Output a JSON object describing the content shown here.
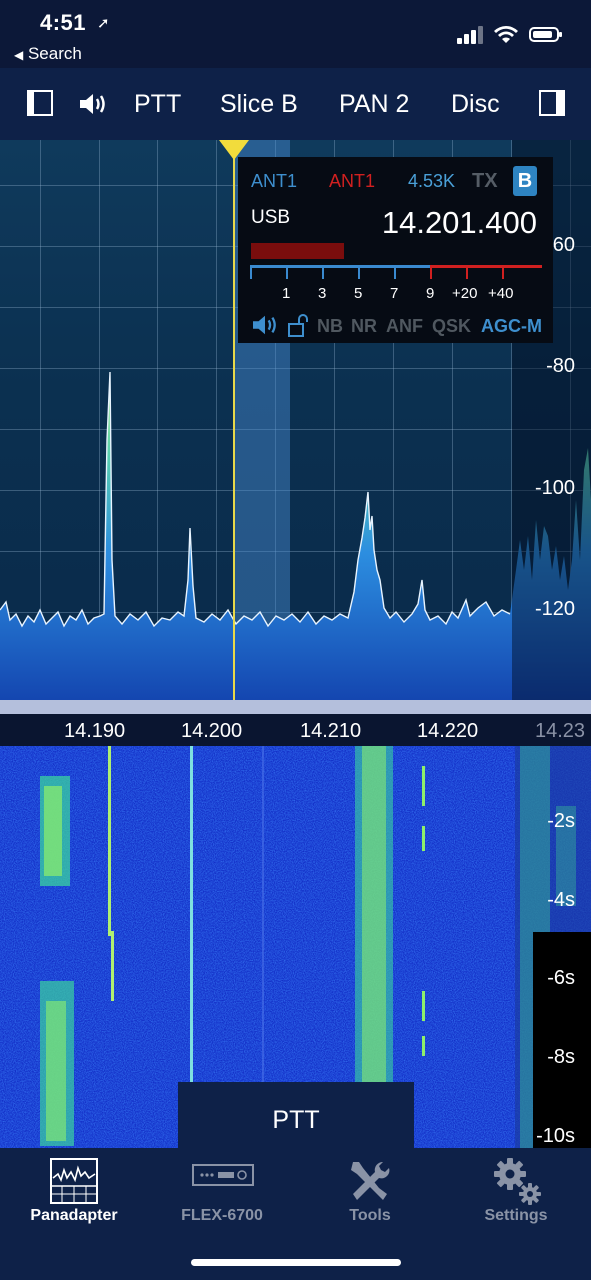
{
  "status_bar": {
    "time": "4:51",
    "back_label": "Search"
  },
  "toolbar": {
    "ptt": "PTT",
    "slice": "Slice B",
    "pan": "PAN 2",
    "disc": "Disc"
  },
  "panadapter": {
    "dbm_labels": [
      "-60",
      "-80",
      "-100",
      "-120"
    ]
  },
  "slice_flag": {
    "rx_ant": "ANT1",
    "tx_ant": "ANT1",
    "filter_width": "4.53K",
    "tx": "TX",
    "slice_letter": "B",
    "mode": "USB",
    "frequency": "14.201.400",
    "s_meter_labels": [
      "1",
      "3",
      "5",
      "7",
      "9",
      "+20",
      "+40"
    ],
    "s_meter_level": 0.32,
    "options": [
      "NB",
      "NR",
      "ANF",
      "QSK"
    ],
    "agc": "AGC-M",
    "colors": {
      "rx_ant": "#3e8fce",
      "tx_ant": "#d02020"
    }
  },
  "frequency_scale": {
    "labels": [
      "14.190",
      "14.200",
      "14.210",
      "14.220",
      "14.23"
    ]
  },
  "waterfall": {
    "time_labels": [
      "-2s",
      "-4s",
      "-6s",
      "-8s",
      "-10s"
    ],
    "ptt_label": "PTT"
  },
  "tabbar": {
    "items": [
      {
        "label": "Panadapter",
        "icon": "panadapter-icon",
        "active": true
      },
      {
        "label": "FLEX-6700",
        "icon": "radio-icon",
        "active": false
      },
      {
        "label": "Tools",
        "icon": "tools-icon",
        "active": false
      },
      {
        "label": "Settings",
        "icon": "settings-icon",
        "active": false
      }
    ]
  }
}
